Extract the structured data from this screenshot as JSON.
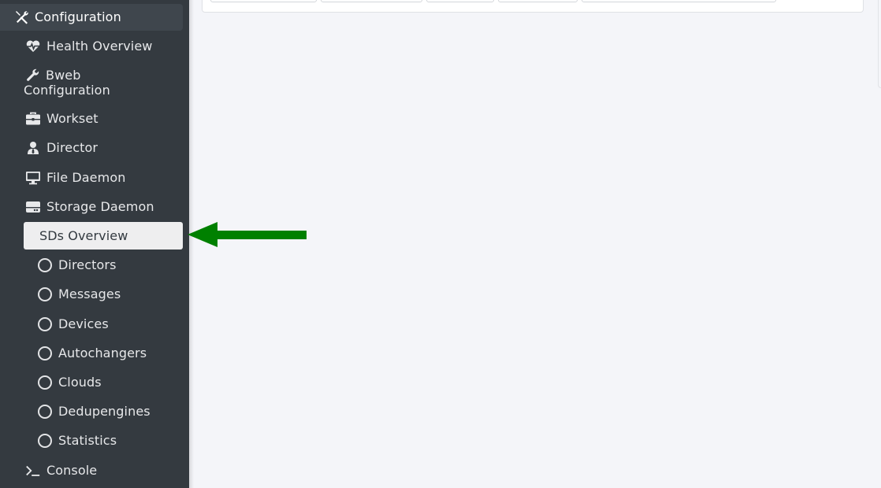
{
  "sidebar": {
    "configuration": "Configuration",
    "health_overview": "Health Overview",
    "bweb_configuration_line1": "Bweb",
    "bweb_configuration_line2": "Configuration",
    "workset": "Workset",
    "director": "Director",
    "file_daemon": "File Daemon",
    "storage_daemon": "Storage Daemon",
    "storage_sub": [
      "SDs Overview",
      "Directors",
      "Messages",
      "Devices",
      "Autochangers",
      "Clouds",
      "Dedupengines",
      "Statistics"
    ],
    "console": "Console",
    "active_item": "SDs Overview"
  },
  "colors": {
    "sidebar_bg": "#343a40",
    "active_bg": "#eeeeef",
    "arrow": "#008000",
    "page_bg": "#f4f5f9"
  },
  "icons": {
    "configuration": "tools-icon",
    "health_overview": "heartbeat-icon",
    "bweb_configuration": "wrench-icon",
    "workset": "briefcase-icon",
    "director": "user-tie-icon",
    "file_daemon": "desktop-icon",
    "storage_daemon": "hdd-icon",
    "storage_sub": "circle-icon",
    "console": "terminal-icon"
  }
}
